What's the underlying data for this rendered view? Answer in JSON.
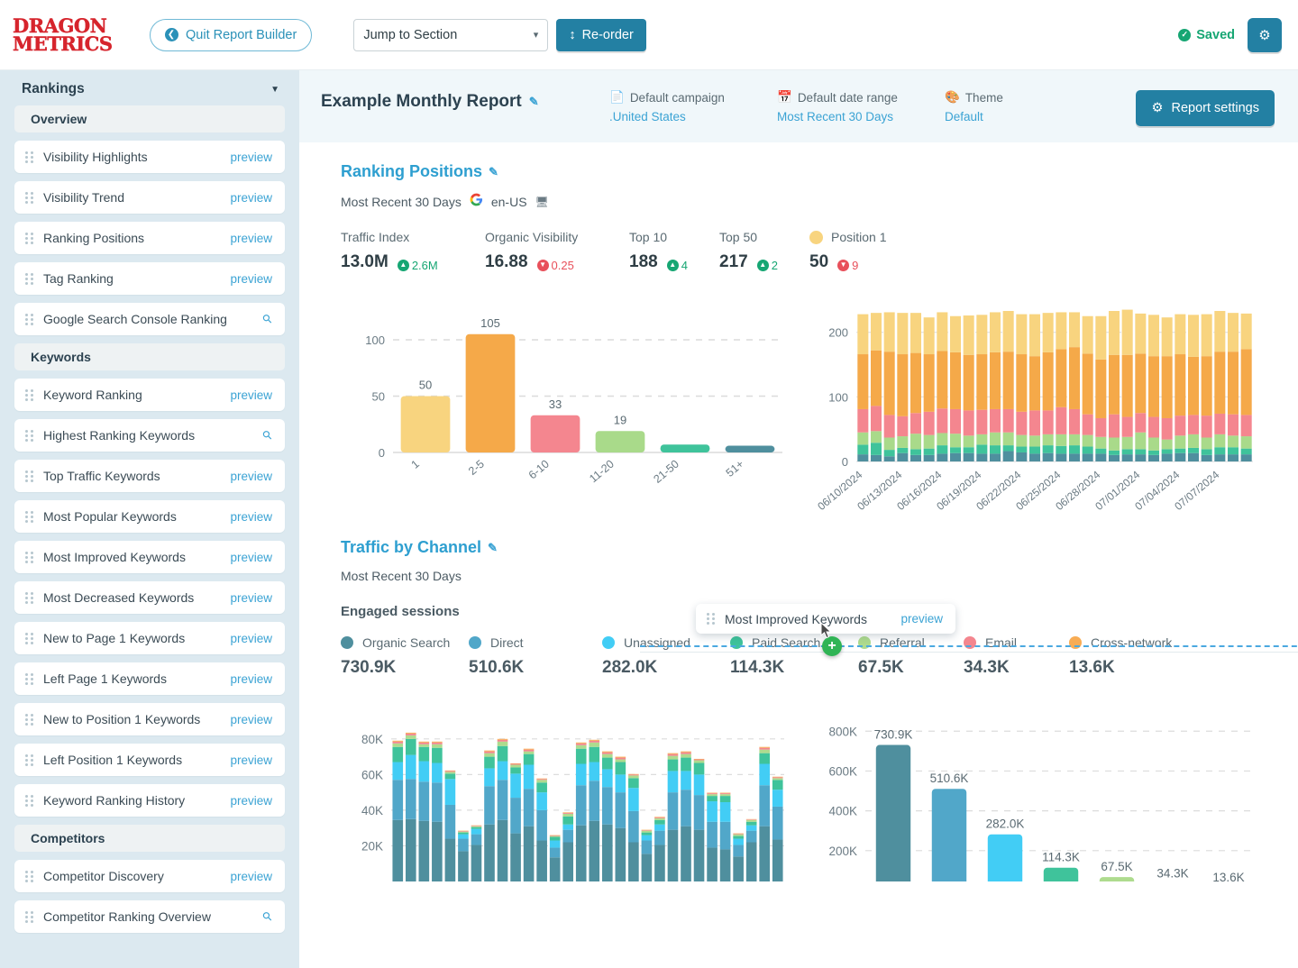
{
  "topbar": {
    "logo_line1": "DRAGON",
    "logo_line2": "METRICS",
    "quit_label": "Quit Report Builder",
    "jump_placeholder": "Jump to Section",
    "reorder_label": "Re-order",
    "saved_label": "Saved",
    "gear_icon": "gear-icon"
  },
  "sidebar": {
    "title": "Rankings",
    "groups": [
      {
        "label": "Overview",
        "items": [
          {
            "label": "Visibility Highlights",
            "action": "preview"
          },
          {
            "label": "Visibility Trend",
            "action": "preview"
          },
          {
            "label": "Ranking Positions",
            "action": "preview"
          },
          {
            "label": "Tag Ranking",
            "action": "preview"
          },
          {
            "label": "Google Search Console Ranking",
            "action": "search"
          }
        ]
      },
      {
        "label": "Keywords",
        "items": [
          {
            "label": "Keyword Ranking",
            "action": "preview"
          },
          {
            "label": "Highest Ranking Keywords",
            "action": "search"
          },
          {
            "label": "Top Traffic Keywords",
            "action": "preview"
          },
          {
            "label": "Most Popular Keywords",
            "action": "preview"
          },
          {
            "label": "Most Improved Keywords",
            "action": "preview"
          },
          {
            "label": "Most Decreased Keywords",
            "action": "preview"
          },
          {
            "label": "New to Page 1 Keywords",
            "action": "preview"
          },
          {
            "label": "Left Page 1 Keywords",
            "action": "preview"
          },
          {
            "label": "New to Position 1 Keywords",
            "action": "preview"
          },
          {
            "label": "Left Position 1 Keywords",
            "action": "preview"
          },
          {
            "label": "Keyword Ranking History",
            "action": "preview"
          }
        ]
      },
      {
        "label": "Competitors",
        "items": [
          {
            "label": "Competitor Discovery",
            "action": "preview"
          },
          {
            "label": "Competitor Ranking Overview",
            "action": "search"
          }
        ]
      }
    ],
    "preview_label": "preview"
  },
  "report_header": {
    "title": "Example Monthly Report",
    "campaign_label": "Default campaign",
    "campaign_value": ".United States",
    "date_label": "Default date range",
    "date_value": "Most Recent 30 Days",
    "theme_label": "Theme",
    "theme_value": "Default",
    "settings_label": "Report settings"
  },
  "ranking_section": {
    "title": "Ranking Positions",
    "subtitle": "Most Recent 30 Days",
    "locale": "en-US",
    "metrics": [
      {
        "label": "Traffic Index",
        "value": "13.0M",
        "delta": "2.6M",
        "direction": "up"
      },
      {
        "label": "Organic Visibility",
        "value": "16.88",
        "delta": "0.25",
        "direction": "down"
      },
      {
        "label": "Top 10",
        "value": "188",
        "delta": "4",
        "direction": "up"
      },
      {
        "label": "Top 50",
        "value": "217",
        "delta": "2",
        "direction": "up"
      },
      {
        "label": "Position 1",
        "value": "50",
        "delta": "9",
        "direction": "down",
        "dot": "#f8d47f"
      }
    ]
  },
  "traffic_section": {
    "title": "Traffic by Channel",
    "subtitle": "Most Recent 30 Days",
    "metric_label": "Engaged sessions",
    "channels": [
      {
        "label": "Organic Search",
        "value": "730.9K",
        "color": "#4f8f9e"
      },
      {
        "label": "Direct",
        "value": "510.6K",
        "color": "#51a7c9"
      },
      {
        "label": "Unassigned",
        "value": "282.0K",
        "color": "#42cdf5"
      },
      {
        "label": "Paid Search",
        "value": "114.3K",
        "color": "#3fc39b"
      },
      {
        "label": "Referral",
        "value": "67.5K",
        "color": "#aedb8e"
      },
      {
        "label": "Email",
        "value": "34.3K",
        "color": "#f4868f"
      },
      {
        "label": "Cross-network",
        "value": "13.6K",
        "color": "#f8ac54"
      }
    ]
  },
  "drag_overlay": {
    "label": "Most Improved Keywords",
    "action_label": "preview",
    "badge": "+"
  },
  "chart_data": [
    {
      "id": "ranking_distribution",
      "type": "bar",
      "title": "",
      "categories": [
        "1",
        "2-5",
        "6-10",
        "11-20",
        "21-50",
        "51+"
      ],
      "values": [
        50,
        105,
        33,
        19,
        7,
        6
      ],
      "labels": [
        "50",
        "105",
        "33",
        "19",
        "",
        ""
      ],
      "colors": [
        "#f8d47f",
        "#f5a949",
        "#f4868f",
        "#a9da8a",
        "#3fc39b",
        "#4f8f9e"
      ],
      "ylim": [
        0,
        120
      ],
      "yticks": [
        0,
        50,
        100
      ],
      "ytick_labels": [
        "0",
        "50",
        "100"
      ],
      "xlabel": "",
      "ylabel": "",
      "grid": true
    },
    {
      "id": "ranking_trend_stacked",
      "type": "bar",
      "stacked": true,
      "x": [
        "06/10/2024",
        "06/11/2024",
        "06/12/2024",
        "06/13/2024",
        "06/14/2024",
        "06/15/2024",
        "06/16/2024",
        "06/17/2024",
        "06/18/2024",
        "06/19/2024",
        "06/20/2024",
        "06/21/2024",
        "06/22/2024",
        "06/23/2024",
        "06/24/2024",
        "06/25/2024",
        "06/26/2024",
        "06/27/2024",
        "06/28/2024",
        "06/29/2024",
        "06/30/2024",
        "07/01/2024",
        "07/02/2024",
        "07/03/2024",
        "07/04/2024",
        "07/05/2024",
        "07/06/2024",
        "07/07/2024",
        "07/08/2024",
        "07/09/2024"
      ],
      "tick_labels": [
        "06/10/2024",
        "06/13/2024",
        "06/16/2024",
        "06/19/2024",
        "06/22/2024",
        "06/25/2024",
        "06/28/2024",
        "07/01/2024",
        "07/04/2024",
        "07/07/2024"
      ],
      "series": [
        {
          "name": "51+",
          "color": "#4f8f9e",
          "values": [
            11,
            10,
            8,
            13,
            10,
            10,
            12,
            13,
            13,
            12,
            12,
            16,
            14,
            12,
            13,
            12,
            12,
            12,
            12,
            10,
            11,
            11,
            10,
            12,
            13,
            13,
            10,
            11,
            11,
            11
          ]
        },
        {
          "name": "21-50",
          "color": "#3fc39b",
          "values": [
            15,
            19,
            10,
            8,
            9,
            10,
            13,
            9,
            9,
            14,
            13,
            9,
            9,
            11,
            12,
            12,
            13,
            11,
            8,
            7,
            8,
            8,
            7,
            7,
            7,
            8,
            9,
            11,
            11,
            9
          ]
        },
        {
          "name": "11-20",
          "color": "#a9da8a",
          "values": [
            19,
            18,
            19,
            18,
            24,
            21,
            19,
            21,
            18,
            16,
            20,
            20,
            18,
            17,
            17,
            18,
            17,
            18,
            18,
            20,
            19,
            26,
            20,
            15,
            20,
            21,
            18,
            20,
            18,
            19
          ]
        },
        {
          "name": "6-10",
          "color": "#f4868f",
          "values": [
            36,
            39,
            35,
            31,
            32,
            36,
            38,
            38,
            39,
            38,
            36,
            36,
            36,
            39,
            37,
            42,
            39,
            32,
            29,
            36,
            31,
            30,
            32,
            33,
            31,
            30,
            34,
            32,
            33,
            33
          ]
        },
        {
          "name": "2-5",
          "color": "#f5a949",
          "values": [
            85,
            86,
            98,
            96,
            93,
            89,
            89,
            88,
            86,
            86,
            88,
            89,
            89,
            84,
            90,
            90,
            96,
            94,
            91,
            92,
            96,
            92,
            94,
            96,
            95,
            90,
            92,
            96,
            97,
            102
          ]
        },
        {
          "name": "1",
          "color": "#f8d47f",
          "values": [
            62,
            58,
            61,
            64,
            62,
            57,
            60,
            56,
            61,
            61,
            62,
            63,
            62,
            65,
            61,
            57,
            54,
            58,
            67,
            68,
            70,
            62,
            64,
            60,
            62,
            65,
            65,
            63,
            60,
            55
          ]
        }
      ],
      "ylim": [
        0,
        240
      ],
      "yticks": [
        0,
        100,
        200
      ],
      "ytick_labels": [
        "0",
        "100",
        "200"
      ],
      "grid": true
    },
    {
      "id": "traffic_daily_stacked",
      "type": "bar",
      "stacked": true,
      "ylim": [
        0,
        88000
      ],
      "yticks": [
        20000,
        40000,
        60000,
        80000
      ],
      "ytick_labels": [
        "20K",
        "40K",
        "60K",
        "80K"
      ],
      "series": [
        {
          "name": "Organic Search",
          "color": "#4f8f9e",
          "values": [
            34500,
            35000,
            34000,
            33500,
            24000,
            17000,
            20500,
            32000,
            34500,
            27000,
            31000,
            23000,
            13500,
            22000,
            31500,
            34000,
            32000,
            30000,
            22000,
            15500,
            20500,
            29000,
            31000,
            29000,
            19000,
            18000,
            14000,
            22000,
            31000,
            23500
          ]
        },
        {
          "name": "Direct",
          "color": "#51a7c9",
          "values": [
            22500,
            22500,
            22000,
            22000,
            19000,
            7000,
            6000,
            21500,
            22500,
            20000,
            21000,
            17000,
            5500,
            7000,
            22500,
            22500,
            21000,
            20000,
            17500,
            7500,
            8000,
            21000,
            20500,
            19500,
            14500,
            15500,
            6500,
            6500,
            23000,
            18500
          ]
        },
        {
          "name": "Unassigned",
          "color": "#42cdf5",
          "values": [
            10000,
            13500,
            11500,
            11000,
            14500,
            2500,
            3000,
            10000,
            10500,
            13500,
            13500,
            10000,
            4000,
            3000,
            12000,
            10500,
            10000,
            10000,
            13000,
            3000,
            3500,
            12000,
            10500,
            11500,
            11500,
            11000,
            3500,
            3000,
            12000,
            9500
          ]
        },
        {
          "name": "Paid Search",
          "color": "#3fc39b",
          "values": [
            8500,
            9000,
            8000,
            8500,
            3000,
            1000,
            1000,
            6500,
            8500,
            3500,
            6000,
            5500,
            2000,
            4500,
            8500,
            8500,
            6500,
            7000,
            5500,
            1500,
            2500,
            6500,
            7500,
            6500,
            3000,
            3500,
            1500,
            2000,
            6000,
            5500
          ]
        },
        {
          "name": "Referral",
          "color": "#aedb8e",
          "values": [
            2000,
            2000,
            1500,
            2000,
            1000,
            500,
            500,
            2000,
            2500,
            1500,
            1500,
            1500,
            500,
            1500,
            2000,
            2500,
            2000,
            1500,
            1500,
            1000,
            1000,
            2000,
            2000,
            1500,
            1000,
            1000,
            1000,
            1000,
            2000,
            1000
          ]
        },
        {
          "name": "Email",
          "color": "#f4868f",
          "values": [
            1000,
            1000,
            1000,
            1000,
            500,
            300,
            300,
            1000,
            1000,
            500,
            1000,
            500,
            300,
            500,
            1000,
            1000,
            1000,
            1000,
            500,
            300,
            500,
            1000,
            1000,
            500,
            500,
            500,
            300,
            300,
            1000,
            500
          ]
        },
        {
          "name": "Cross-network",
          "color": "#f8ac54",
          "values": [
            500,
            500,
            500,
            500,
            300,
            200,
            200,
            500,
            500,
            300,
            500,
            300,
            200,
            300,
            500,
            500,
            500,
            500,
            300,
            200,
            300,
            500,
            500,
            300,
            300,
            300,
            200,
            200,
            500,
            300
          ]
        }
      ],
      "grid": true
    },
    {
      "id": "traffic_by_channel_totals",
      "type": "bar",
      "categories": [
        "Organic Search",
        "Direct",
        "Unassigned",
        "Paid Search",
        "Referral",
        "Email",
        "Cross-network"
      ],
      "values": [
        730900,
        510600,
        282000,
        114300,
        67500,
        34300,
        13600
      ],
      "labels": [
        "730.9K",
        "510.6K",
        "282.0K",
        "114.3K",
        "67.5K",
        "34.3K",
        "13.6K"
      ],
      "colors": [
        "#4f8f9e",
        "#51a7c9",
        "#42cdf5",
        "#3fc39b",
        "#aedb8e",
        "#f4868f",
        "#f8ac54"
      ],
      "ylim": [
        0,
        860000
      ],
      "yticks": [
        200000,
        400000,
        600000,
        800000
      ],
      "ytick_labels": [
        "200K",
        "400K",
        "600K",
        "800K"
      ],
      "grid": true
    }
  ]
}
